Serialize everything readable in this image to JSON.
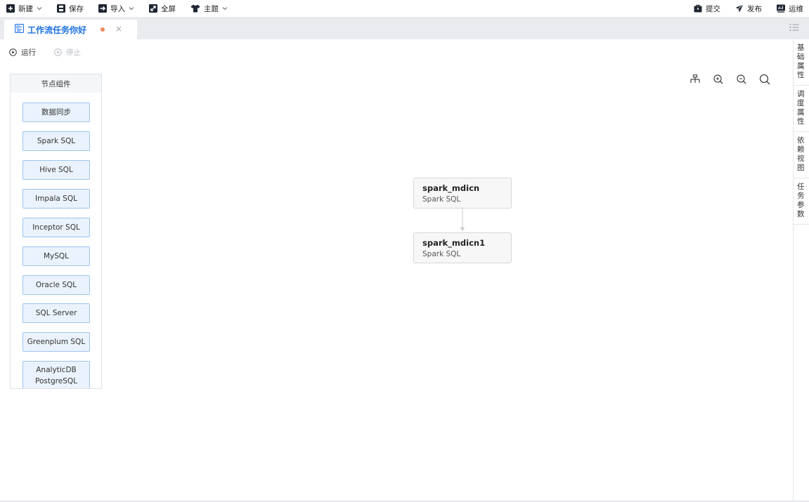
{
  "toolbar": {
    "new_label": "新建",
    "save_label": "保存",
    "import_label": "导入",
    "fullscreen_label": "全屏",
    "theme_label": "主题",
    "submit_label": "提交",
    "publish_label": "发布",
    "ops_label": "运维"
  },
  "tab": {
    "title": "工作流任务你好",
    "close_glyph": "×"
  },
  "runbar": {
    "run_label": "运行",
    "stop_label": "停止"
  },
  "node_panel": {
    "title": "节点组件",
    "items": [
      "数据同步",
      "Spark SQL",
      "Hive SQL",
      "Impala SQL",
      "Inceptor SQL",
      "MySQL",
      "Oracle SQL",
      "SQL Server",
      "Greenplum SQL",
      "AnalyticDB PostgreSQL"
    ]
  },
  "workflow": {
    "nodes": [
      {
        "name": "spark_mdicn",
        "type": "Spark SQL"
      },
      {
        "name": "spark_mdicn1",
        "type": "Spark SQL"
      }
    ]
  },
  "right_sidebar": {
    "items": [
      "基础属性",
      "调度属性",
      "依赖视图",
      "任务参数"
    ]
  },
  "colors": {
    "accent": "#1a6fe0",
    "node_bg": "#eaf3fd",
    "node_border": "#9cc4ef",
    "unsaved_dot": "#f08a5d"
  }
}
